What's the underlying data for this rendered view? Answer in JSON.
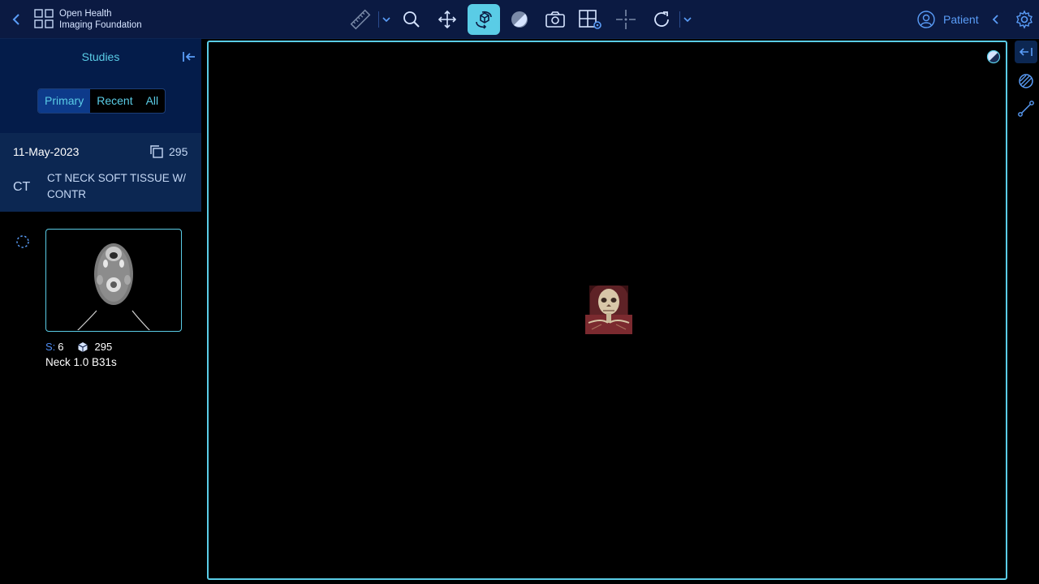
{
  "header": {
    "brand_line1": "Open Health",
    "brand_line2": "Imaging Foundation",
    "patient_label": "Patient",
    "tools": [
      {
        "name": "measure-tool",
        "icon": "ruler-icon",
        "active": false
      },
      {
        "name": "zoom-tool",
        "icon": "magnifier-icon",
        "active": false
      },
      {
        "name": "pan-tool",
        "icon": "move-arrows-icon",
        "active": false
      },
      {
        "name": "rotate-3d-tool",
        "icon": "rotate-3d-icon",
        "active": true
      },
      {
        "name": "window-level-tool",
        "icon": "contrast-icon",
        "active": false
      },
      {
        "name": "capture-tool",
        "icon": "camera-icon",
        "active": false
      },
      {
        "name": "layout-tool",
        "icon": "layout-grid-gear-icon",
        "active": false
      },
      {
        "name": "crosshairs-tool",
        "icon": "crosshair-icon",
        "active": false
      },
      {
        "name": "reset-tool",
        "icon": "reset-rotate-icon",
        "active": false
      }
    ]
  },
  "sidebar": {
    "title": "Studies",
    "tabs": [
      {
        "label": "Primary",
        "active": true
      },
      {
        "label": "Recent",
        "active": false
      },
      {
        "label": "All",
        "active": false
      }
    ],
    "study": {
      "date": "11-May-2023",
      "instance_count": "295",
      "modality": "CT",
      "description": "CT NECK SOFT TISSUE W/ CONTR"
    },
    "series": {
      "s_label": "S:",
      "number": "6",
      "instances": "295",
      "description": "Neck 1.0 B31s"
    }
  },
  "colors": {
    "header_bg": "#0b1a42",
    "accent": "#5acce6",
    "active_tool_bg": "#5acce6",
    "panel_bg": "#041c4a",
    "study_card_bg": "#0c2752",
    "link_blue": "#5a9df8"
  }
}
